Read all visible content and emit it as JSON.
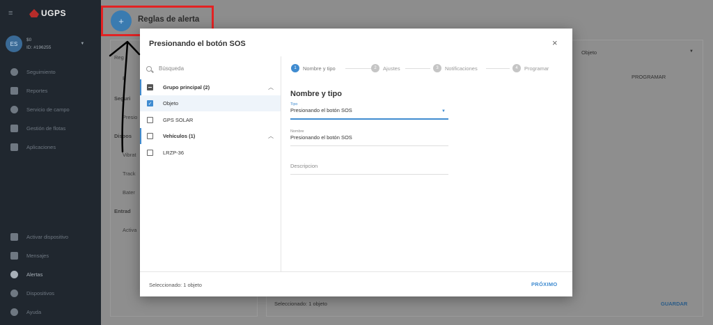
{
  "sidebar": {
    "logo_text": "UGPS",
    "user": {
      "initials": "ES",
      "balance": "$0",
      "id": "ID: #196255"
    },
    "nav": [
      {
        "label": "Seguimiento",
        "icon": "globe-icon"
      },
      {
        "label": "Reportes",
        "icon": "report-icon"
      },
      {
        "label": "Servicio de campo",
        "icon": "location-icon"
      },
      {
        "label": "Gestión de flotas",
        "icon": "car-icon"
      },
      {
        "label": "Aplicaciones",
        "icon": "puzzle-icon"
      }
    ],
    "bottom": [
      {
        "label": "Activar dispositivo",
        "icon": "login-icon"
      },
      {
        "label": "Mensajes",
        "icon": "message-icon"
      },
      {
        "label": "Alertas",
        "icon": "bell-icon"
      },
      {
        "label": "Dispositivos",
        "icon": "gear-icon"
      },
      {
        "label": "Ayuda",
        "icon": "help-icon"
      }
    ]
  },
  "header": {
    "title": "Reglas de alerta",
    "fab_label": "+"
  },
  "background": {
    "left_items": [
      "Reg",
      "B",
      "Seguri",
      "Presio",
      "Dispos",
      "Vibrat",
      "Track",
      "Bater",
      "Entrad",
      "Activa"
    ],
    "select_value": "Objeto",
    "programar": "PROGRAMAR",
    "footer": "Seleccionado: 1 objeto",
    "save": "GUARDAR"
  },
  "modal": {
    "title": "Presionando el botón SOS",
    "close": "×",
    "search_placeholder": "Búsqueda",
    "tree": [
      {
        "label": "Grupo principal (2)",
        "bold": true,
        "state": "partial",
        "chevron": "^"
      },
      {
        "label": "Objeto",
        "bold": false,
        "state": "checked",
        "chevron": ""
      },
      {
        "label": "GPS SOLAR",
        "bold": false,
        "state": "unchecked",
        "chevron": ""
      },
      {
        "label": "Vehículos (1)",
        "bold": true,
        "state": "unchecked",
        "chevron": "^"
      },
      {
        "label": "LRZP-36",
        "bold": false,
        "state": "unchecked",
        "chevron": ""
      }
    ],
    "steps": [
      {
        "num": "1",
        "label": "Nombre y tipo",
        "active": true
      },
      {
        "num": "2",
        "label": "Ajustes",
        "active": false
      },
      {
        "num": "3",
        "label": "Notificaciones",
        "active": false
      },
      {
        "num": "4",
        "label": "Programar",
        "active": false
      }
    ],
    "form": {
      "title": "Nombre y tipo",
      "type_label": "Tipo",
      "type_value": "Presionando el botón SOS",
      "name_label": "Nombre",
      "name_value": "Presionando el botón SOS",
      "description_placeholder": "Descripcion"
    },
    "footer_text": "Seleccionado: 1 objeto",
    "next_label": "PRÓXIMO"
  },
  "colors": {
    "accent": "#3f8bd0",
    "sidebar": "#20272f",
    "highlight": "#e32223"
  }
}
